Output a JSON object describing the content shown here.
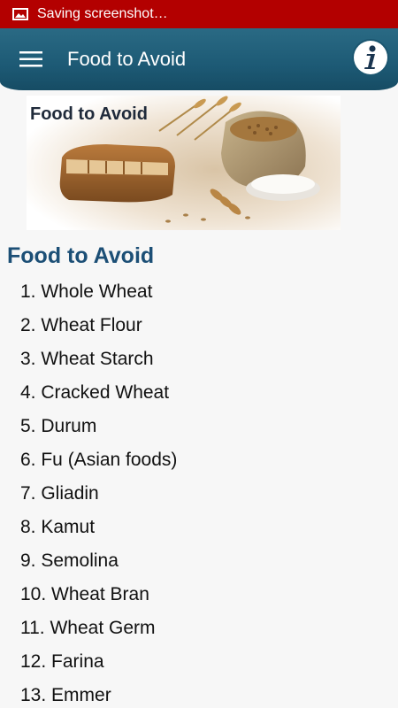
{
  "status_bar": {
    "text": "Saving screenshot…",
    "icon": "image-icon"
  },
  "app_bar": {
    "title": "Food to Avoid",
    "menu_icon": "hamburger-icon",
    "info_icon": "info-icon"
  },
  "hero": {
    "caption": "Food to Avoid",
    "image": "wheat-bread-grains-photo"
  },
  "section": {
    "title": "Food to Avoid",
    "items": [
      "1. Whole Wheat",
      "2. Wheat Flour",
      "3. Wheat Starch",
      "4. Cracked Wheat",
      "5. Durum",
      "6. Fu (Asian foods)",
      "7. Gliadin",
      "8. Kamut",
      "9. Semolina",
      "10. Wheat Bran",
      "11. Wheat Germ",
      "12. Farina",
      "13. Emmer"
    ]
  },
  "colors": {
    "status_bar": "#b30000",
    "app_bar": "#1d5a75",
    "heading": "#1c4f76"
  }
}
